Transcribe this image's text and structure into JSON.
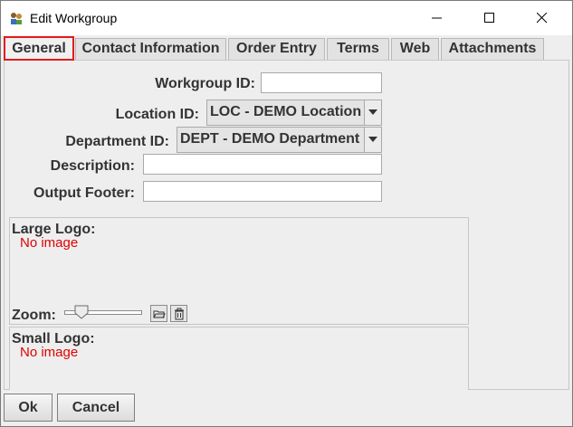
{
  "window": {
    "title": "Edit Workgroup"
  },
  "tabs": [
    {
      "label": "General",
      "selected": true
    },
    {
      "label": "Contact Information",
      "selected": false
    },
    {
      "label": "Order Entry",
      "selected": false
    },
    {
      "label": "Terms",
      "selected": false
    },
    {
      "label": "Web",
      "selected": false
    },
    {
      "label": "Attachments",
      "selected": false
    }
  ],
  "form": {
    "workgroup_id": {
      "label": "Workgroup ID:",
      "value": ""
    },
    "location_id": {
      "label": "Location ID:",
      "value": "LOC - DEMO Location"
    },
    "department_id": {
      "label": "Department ID:",
      "value": "DEPT - DEMO Department"
    },
    "description": {
      "label": "Description:",
      "value": ""
    },
    "output_footer": {
      "label": "Output Footer:",
      "value": ""
    }
  },
  "large_logo": {
    "label": "Large Logo:",
    "placeholder": "No image",
    "zoom_label": "Zoom:",
    "zoom_level": 0.15
  },
  "small_logo": {
    "label": "Small Logo:",
    "placeholder": "No image"
  },
  "buttons": {
    "ok": "Ok",
    "cancel": "Cancel"
  },
  "colors": {
    "selected_tab_outline": "#e11c1c",
    "no_image_text": "#e00000"
  },
  "icons": {
    "app": "workgroup-app-icon",
    "minimize": "minimize-icon",
    "maximize": "maximize-icon",
    "close": "close-icon",
    "dropdown": "chevron-down-icon",
    "open_file": "open-folder-icon",
    "delete": "trash-icon"
  }
}
